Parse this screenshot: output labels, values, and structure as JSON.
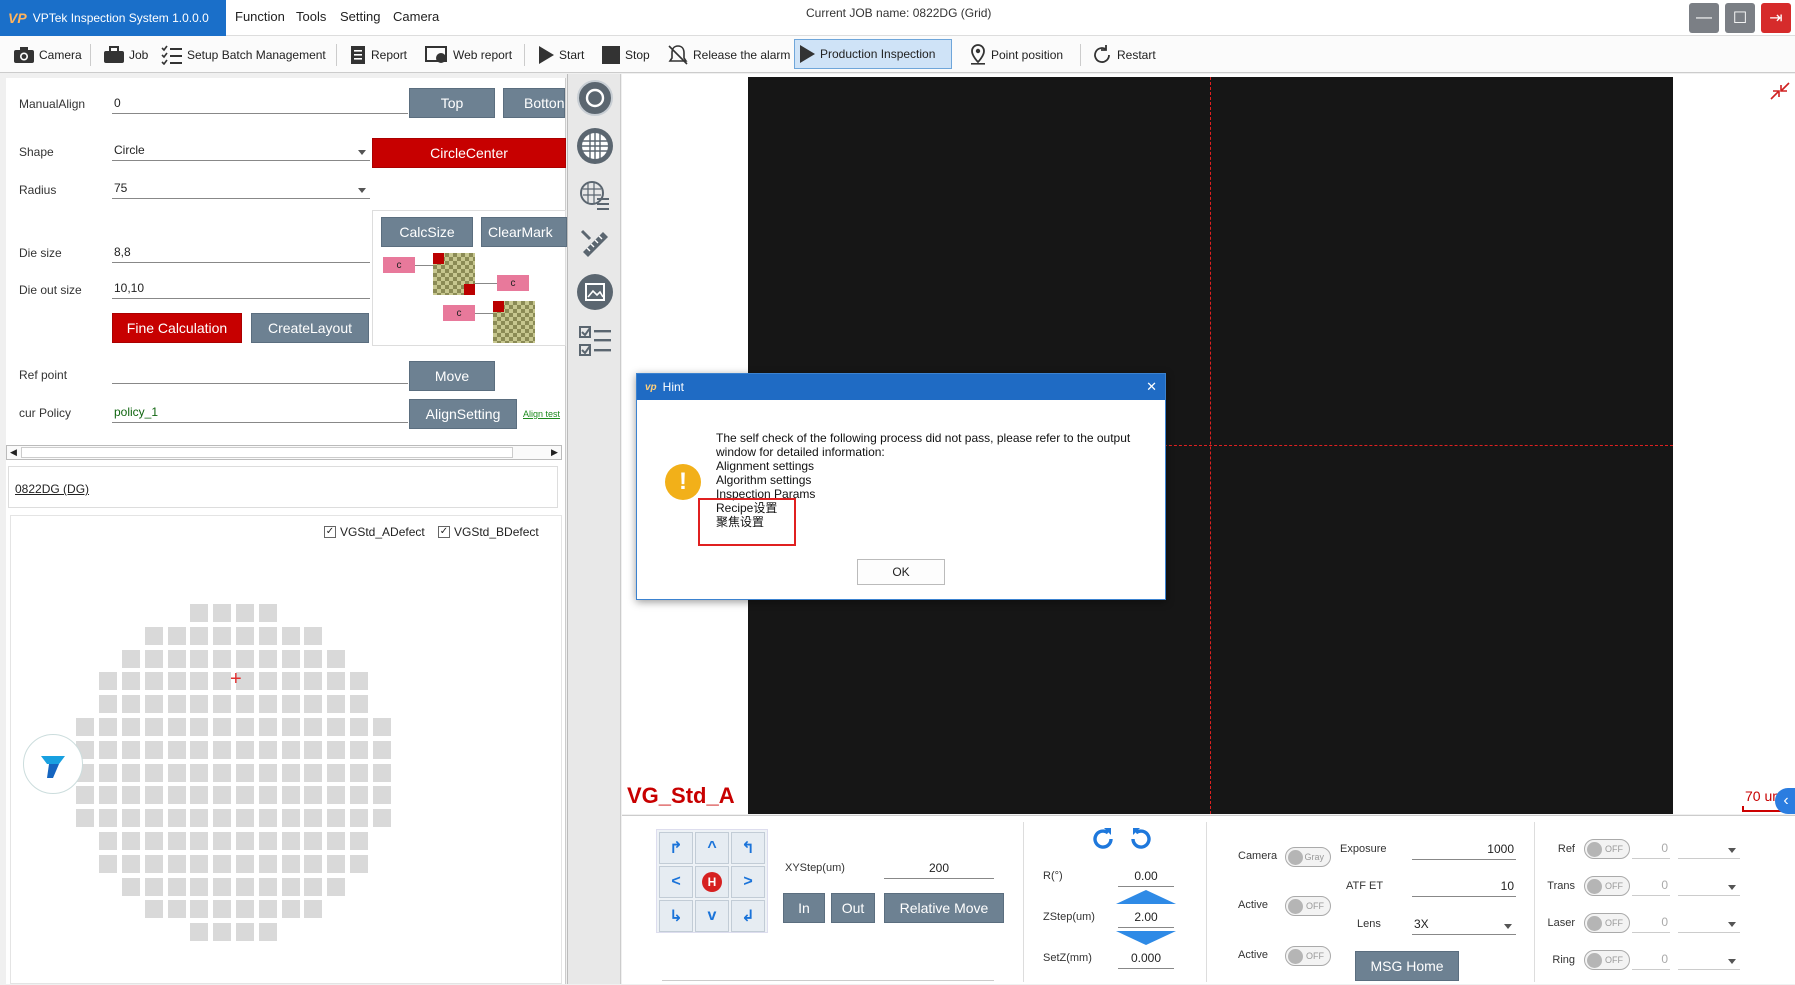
{
  "app": {
    "title": "VPTek Inspection System 1.0.0.0",
    "logo": "VP",
    "job_label": "Current JOB name:",
    "job_name": "0822DG (Grid)"
  },
  "menu": [
    "Function",
    "Tools",
    "Setting",
    "Camera"
  ],
  "window_controls": {
    "minimize": "—",
    "maximize": "☐",
    "close": "⇥"
  },
  "toolbar": {
    "camera": "Camera",
    "job": "Job",
    "setup_batch": "Setup Batch Management",
    "report": "Report",
    "web_report": "Web report",
    "start": "Start",
    "stop": "Stop",
    "release_alarm": "Release the alarm",
    "production_inspection": "Production Inspection",
    "point_position": "Point position",
    "restart": "Restart"
  },
  "align": {
    "manual_align_label": "ManualAlign",
    "manual_align_value": "0",
    "top_btn": "Top",
    "bottom_btn": "Botton",
    "shape_label": "Shape",
    "shape_value": "Circle",
    "circle_center_btn": "CircleCenter",
    "radius_label": "Radius",
    "radius_value": "75",
    "calc_size_btn": "CalcSize",
    "clear_mark_btn": "ClearMark",
    "die_size_label": "Die size",
    "die_size_value": "8,8",
    "die_out_label": "Die out size",
    "die_out_value": "10,10",
    "fine_calc_btn": "Fine Calculation",
    "create_layout_btn": "CreateLayout",
    "ref_point_label": "Ref point",
    "ref_point_value": "",
    "move_btn": "Move",
    "policy_label": "cur Policy",
    "policy_value": "policy_1",
    "align_setting_btn": "AlignSetting",
    "align_test_link": "Align test",
    "c_marker": "c"
  },
  "map": {
    "job_link": "0822DG (DG)",
    "checkboxes": [
      {
        "label": "VGStd_ADefect",
        "checked": true
      },
      {
        "label": "VGStd_BDefect",
        "checked": true
      }
    ],
    "rows": [
      4,
      8,
      10,
      12,
      12,
      14,
      14,
      14,
      14,
      14,
      12,
      12,
      10,
      8,
      4
    ],
    "marker": "+"
  },
  "viewer": {
    "overlay_label": "VG_Std_A",
    "scale_label": "70 um",
    "collapse": "‹"
  },
  "dialog": {
    "title": "Hint",
    "close": "✕",
    "icon": "!",
    "lines": [
      "The self check of the following process did not pass, please refer to the output",
      "window for detailed information:",
      "Alignment settings",
      "Algorithm settings",
      "Inspection Params",
      "Recipe设置",
      "聚焦设置"
    ],
    "ok": "OK"
  },
  "motion": {
    "arrows": [
      "↱",
      "^",
      "↰",
      "<",
      "H",
      ">",
      "↳",
      "v",
      "↲"
    ],
    "xystep_label": "XYStep(um)",
    "xystep_value": "200",
    "in_btn": "In",
    "out_btn": "Out",
    "relative_move_btn": "Relative Move",
    "r_label": "R(°)",
    "r_value": "0.00",
    "zstep_label": "ZStep(um)",
    "zstep_value": "2.00",
    "setz_label": "SetZ(mm)",
    "setz_value": "0.000"
  },
  "camera_ctrl": {
    "camera_label": "Camera",
    "camera_toggle": "Gray",
    "active1_label": "Active",
    "active1_toggle": "OFF",
    "active2_label": "Active",
    "active2_toggle": "OFF",
    "exposure_label": "Exposure",
    "exposure_value": "1000",
    "atf_label": "ATF ET",
    "atf_value": "10",
    "lens_label": "Lens",
    "lens_value": "3X",
    "msg_home_btn": "MSG Home"
  },
  "lights": [
    {
      "label": "Ref",
      "toggle": "OFF",
      "value": "0"
    },
    {
      "label": "Trans",
      "toggle": "OFF",
      "value": "0"
    },
    {
      "label": "Laser",
      "toggle": "OFF",
      "value": "0"
    },
    {
      "label": "Ring",
      "toggle": "OFF",
      "value": "0"
    }
  ],
  "colors": {
    "accent": "#1a6fc9",
    "danger": "#c70000",
    "steel": "#6d8192"
  }
}
